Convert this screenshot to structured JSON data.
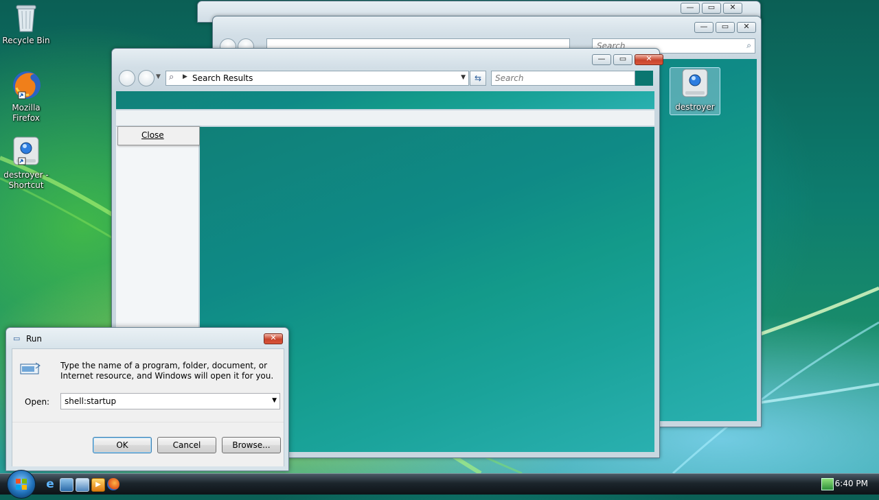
{
  "desktop": {
    "icons": [
      {
        "label": "Recycle Bin"
      },
      {
        "label": "Mozilla Firefox"
      },
      {
        "label": "destroyer - Shortcut"
      },
      {
        "label": "destroyer"
      }
    ]
  },
  "back_window_2": {
    "search_placeholder": "Search",
    "caption_buttons": {
      "minimize": "—",
      "maximize": "▭",
      "close": "✕"
    }
  },
  "front_window": {
    "address": "Search Results",
    "search_placeholder": "Search",
    "context_menu": {
      "item": "Close"
    },
    "caption_buttons": {
      "minimize": "—",
      "maximize": "▭",
      "close": "✕"
    }
  },
  "run_dialog": {
    "title": "Run",
    "description": "Type the name of a program, folder, document, or Internet resource, and Windows will open it for you.",
    "open_label": "Open:",
    "open_value": "shell:startup",
    "buttons": {
      "ok": "OK",
      "cancel": "Cancel",
      "browse": "Browse..."
    }
  },
  "taskbar": {
    "clock": "6:40 PM",
    "quick_launch": [
      "internet-explorer-icon",
      "show-desktop-icon",
      "switch-windows-icon",
      "media-player-icon",
      "firefox-icon"
    ]
  },
  "colors": {
    "teal_pane": "#0b7670",
    "close_red": "#c8442c"
  }
}
